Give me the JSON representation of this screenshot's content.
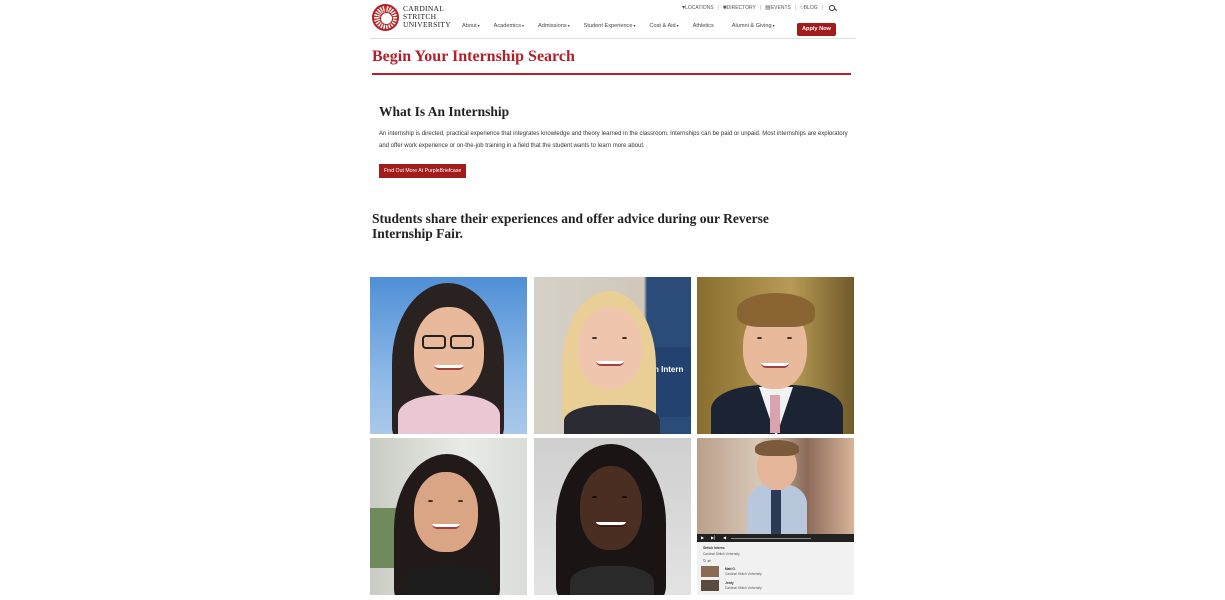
{
  "header": {
    "logo_lines": [
      "CARDINAL",
      "STRITCH",
      "UNIVERSITY"
    ],
    "utility": {
      "locations": "LOCATIONS",
      "directory": "DIRECTORY",
      "events": "EVENTS",
      "blog": "BLOG"
    },
    "nav": [
      {
        "label": "About",
        "has_caret": true
      },
      {
        "label": "Academics",
        "has_caret": true
      },
      {
        "label": "Admissions",
        "has_caret": true
      },
      {
        "label": "Student Experience",
        "has_caret": true
      },
      {
        "label": "Cost & Aid",
        "has_caret": true
      },
      {
        "label": "Athletics",
        "has_caret": false
      },
      {
        "label": "Alumni & Giving",
        "has_caret": true
      }
    ],
    "apply_label": "Apply Now"
  },
  "page": {
    "title": "Begin Your Internship Search",
    "section_title": "What Is An Internship",
    "paragraph": "An internship is directed, practical experience that integrates knowledge and theory learned in the classroom. Internships can be paid or unpaid. Most internships are exploratory and offer work experience or on-the-job training in a field that the student wants to learn more about.",
    "cta_label": "Find Out More At PurpleBriefcase",
    "fair_heading": "Students share their experiences and offer advice during our Reverse Internship Fair."
  },
  "video_panel": {
    "playlist_title": "Stritch Interns",
    "channel": "Cardinal Stritch University",
    "items": [
      {
        "title": "Matt G.",
        "channel": "Cardinal Stritch University"
      },
      {
        "title": "Jordy",
        "channel": "Cardinal Stritch University"
      }
    ]
  },
  "colors": {
    "brand_red": "#b3202a",
    "button_red": "#a21c1c"
  }
}
